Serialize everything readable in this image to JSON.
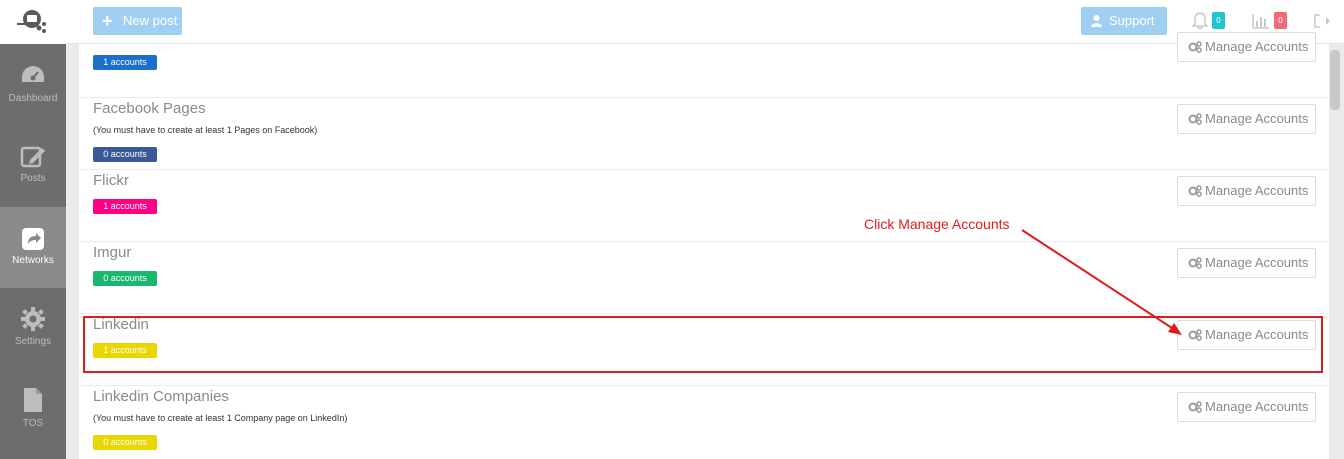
{
  "sidebar": {
    "items": [
      {
        "label": "Dashboard",
        "icon": "dashboard-icon"
      },
      {
        "label": "Posts",
        "icon": "edit-icon"
      },
      {
        "label": "Networks",
        "icon": "share-icon",
        "active": true
      },
      {
        "label": "Settings",
        "icon": "gear-icon"
      },
      {
        "label": "TOS",
        "icon": "document-icon"
      }
    ]
  },
  "topbar": {
    "new_post_label": "New post",
    "support_label": "Support",
    "notifications_count": "0",
    "stats_count": "0"
  },
  "networks": [
    {
      "title": "",
      "note": "",
      "accounts": "1 accounts",
      "badge_color": "#1d6fce",
      "manage_label": "Manage Accounts"
    },
    {
      "title": "Facebook Pages",
      "note": "(You must have to create at least 1 Pages on Facebook)",
      "accounts": "0 accounts",
      "badge_color": "#3b5998",
      "manage_label": "Manage Accounts"
    },
    {
      "title": "Flickr",
      "note": "",
      "accounts": "1 accounts",
      "badge_color": "#ff0084",
      "manage_label": "Manage Accounts"
    },
    {
      "title": "Imgur",
      "note": "",
      "accounts": "0 accounts",
      "badge_color": "#1bb76e",
      "manage_label": "Manage Accounts"
    },
    {
      "title": "Linkedin",
      "note": "",
      "accounts": "1 accounts",
      "badge_color": "#e8d700",
      "manage_label": "Manage Accounts"
    },
    {
      "title": "Linkedin Companies",
      "note": "(You must have to create at least 1 Company page on LinkedIn)",
      "accounts": "0 accounts",
      "badge_color": "#e8d700",
      "manage_label": "Manage Accounts"
    }
  ],
  "annotation": {
    "text": "Click Manage Accounts",
    "color": "#e01b1b"
  },
  "colors": {
    "accent": "#9fd0f4",
    "notif_badge": "#20c5cf",
    "stats_badge": "#f06b78"
  }
}
